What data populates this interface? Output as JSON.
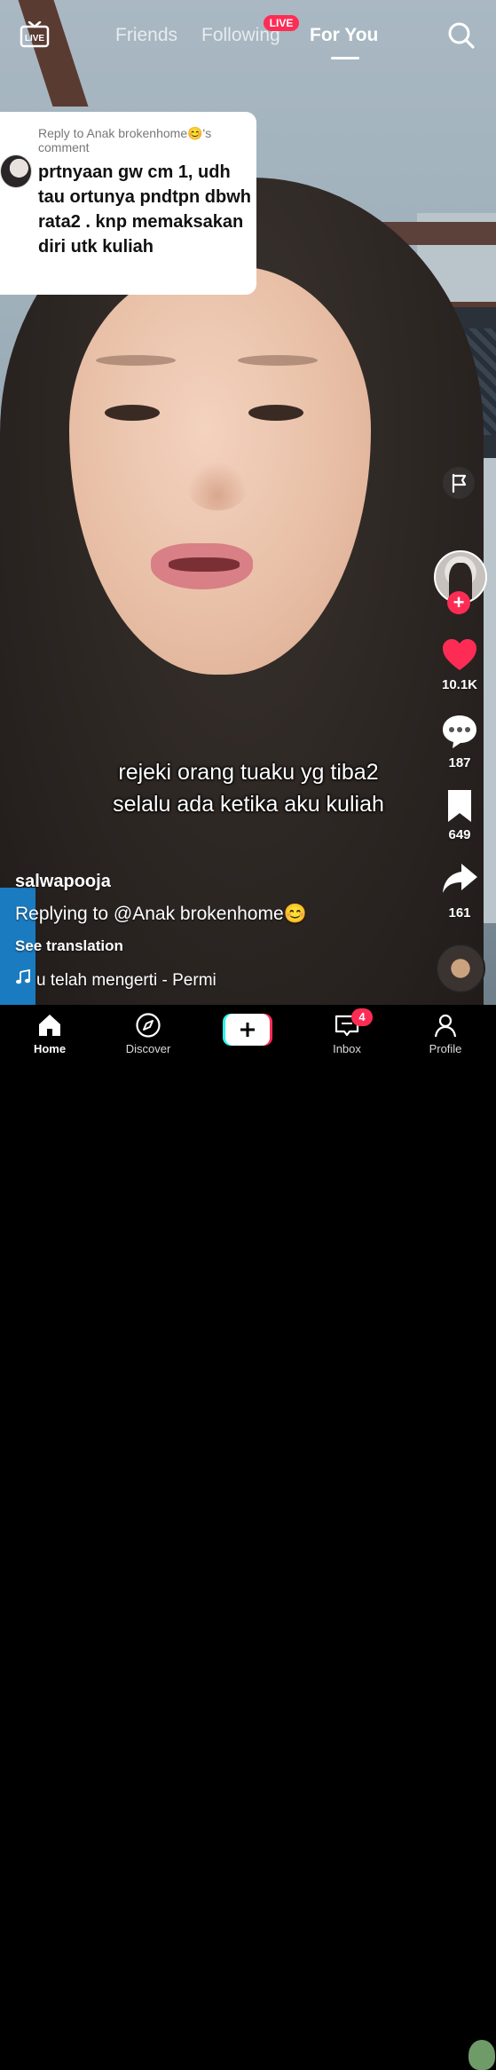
{
  "topbar": {
    "tabs": [
      {
        "label": "Friends",
        "active": false
      },
      {
        "label": "Following",
        "active": false
      },
      {
        "label": "For You",
        "active": true
      }
    ],
    "live_badge": "LIVE",
    "live_icon_label": "LIVE",
    "icons": [
      "live-icon",
      "search-icon"
    ]
  },
  "reply_card": {
    "header": "Reply to Anak brokenhome😊's comment",
    "comment": "prtnyaan gw cm 1, udh tau ortunya pndtpn dbwh rata2 . knp memaksakan diri utk kuliah"
  },
  "overlay_caption": {
    "line1": "rejeki orang tuaku yg tiba2",
    "line2": "selalu ada ketika aku kuliah"
  },
  "post": {
    "username": "salwapooja",
    "description": "Replying to @Anak brokenhome😊",
    "see_translation": "See translation",
    "music": "u telah mengerti - Permi"
  },
  "rail": {
    "likes": "10.1K",
    "comments": "187",
    "saves": "649",
    "shares": "161",
    "follow_symbol": "+",
    "like_color": "#fe2c55"
  },
  "bottom_nav": {
    "items": [
      {
        "label": "Home",
        "icon": "home-icon",
        "active": true
      },
      {
        "label": "Discover",
        "icon": "compass-icon",
        "active": false
      },
      {
        "label": "Inbox",
        "icon": "inbox-icon",
        "active": false,
        "badge": "4"
      },
      {
        "label": "Profile",
        "icon": "profile-icon",
        "active": false
      }
    ],
    "create_symbol": "+"
  },
  "colors": {
    "accent": "#fe2c55",
    "cyan": "#25f4ee"
  }
}
